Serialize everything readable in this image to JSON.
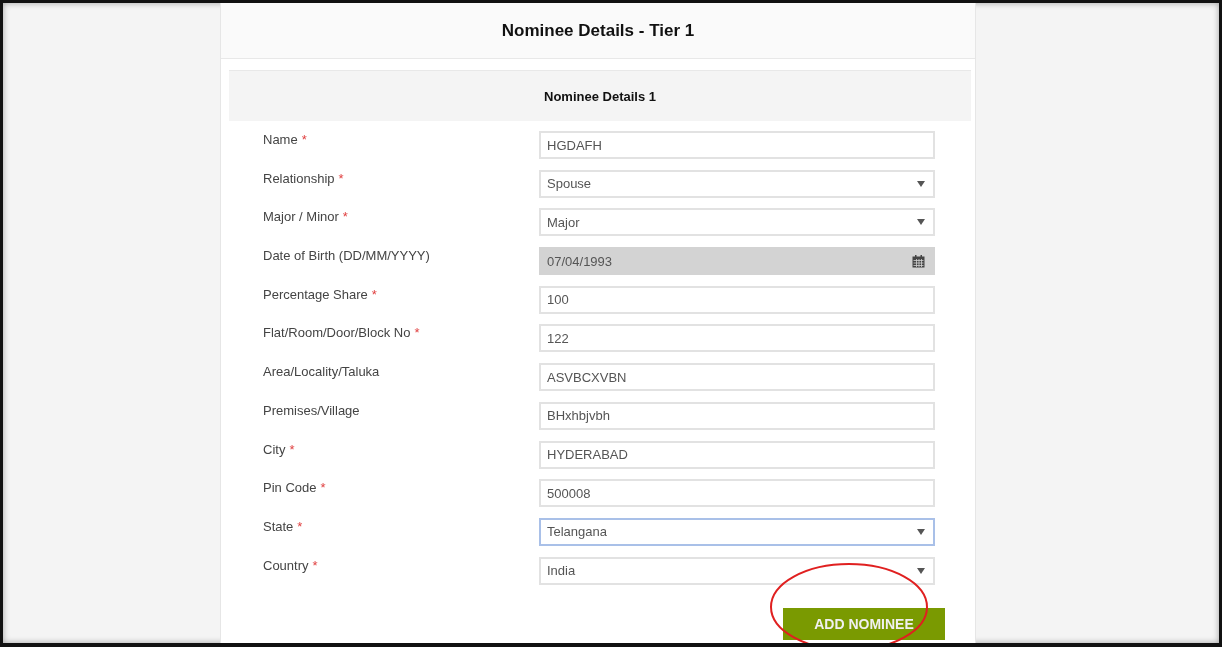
{
  "page_title": "Nominee Details - Tier 1",
  "section_title": "Nominee Details 1",
  "fields": [
    {
      "label": "Name",
      "required": true,
      "kind": "text",
      "value": "HGDAFH",
      "disabled": false,
      "focused": false
    },
    {
      "label": "Relationship",
      "required": true,
      "kind": "select",
      "value": "Spouse",
      "disabled": false,
      "focused": false
    },
    {
      "label": "Major / Minor",
      "required": true,
      "kind": "select",
      "value": "Major",
      "disabled": false,
      "focused": false
    },
    {
      "label": "Date of Birth (DD/MM/YYYY)",
      "required": false,
      "kind": "date",
      "value": "07/04/1993",
      "disabled": true,
      "focused": false
    },
    {
      "label": "Percentage Share",
      "required": true,
      "kind": "text",
      "value": "100",
      "disabled": false,
      "focused": false
    },
    {
      "label": "Flat/Room/Door/Block No",
      "required": true,
      "kind": "text",
      "value": "122",
      "disabled": false,
      "focused": false
    },
    {
      "label": "Area/Locality/Taluka",
      "required": false,
      "kind": "text",
      "value": "ASVBCXVBN",
      "disabled": false,
      "focused": false
    },
    {
      "label": "Premises/Village",
      "required": false,
      "kind": "text",
      "value": "BHxhbjvbh",
      "disabled": false,
      "focused": false
    },
    {
      "label": "City",
      "required": true,
      "kind": "text",
      "value": "HYDERABAD",
      "disabled": false,
      "focused": false
    },
    {
      "label": "Pin Code",
      "required": true,
      "kind": "text",
      "value": "500008",
      "disabled": false,
      "focused": false
    },
    {
      "label": "State",
      "required": true,
      "kind": "select",
      "value": "Telangana",
      "disabled": false,
      "focused": true
    },
    {
      "label": "Country",
      "required": true,
      "kind": "select",
      "value": "India",
      "disabled": false,
      "focused": false
    }
  ],
  "required_mark": "*",
  "add_button": {
    "label": "ADD NOMINEE",
    "circled": true
  }
}
